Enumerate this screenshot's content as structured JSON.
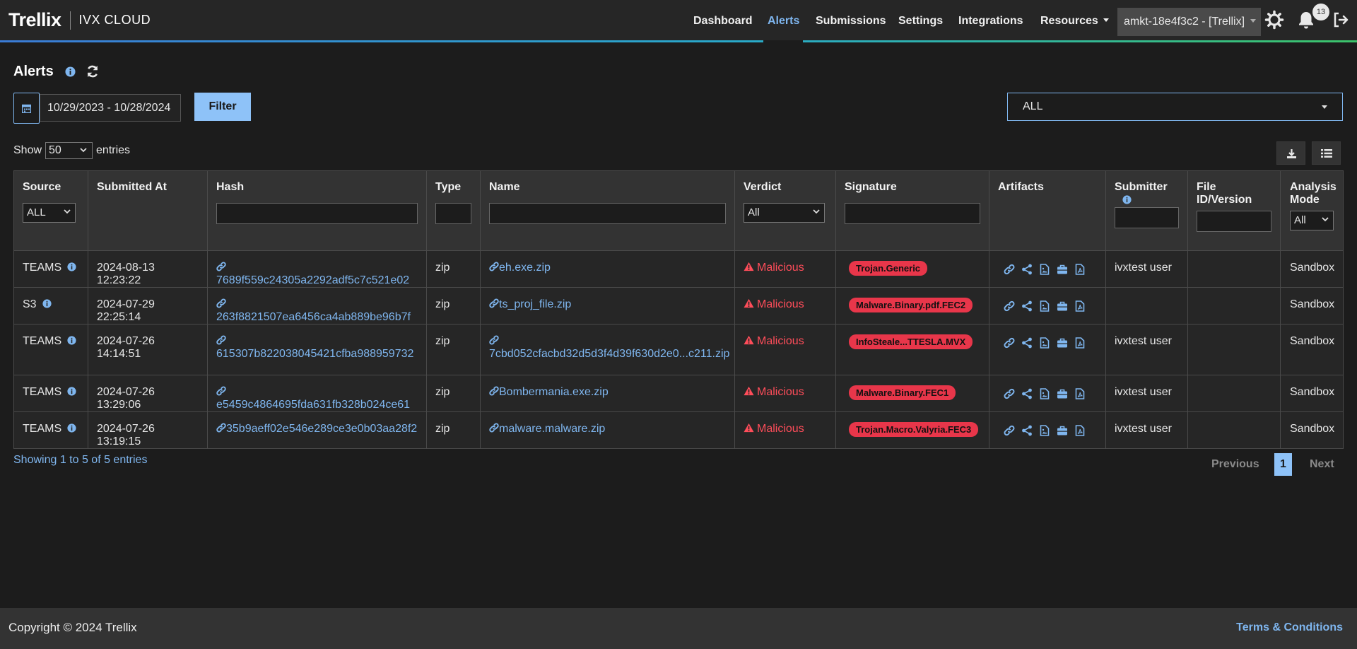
{
  "header": {
    "logo": "Trellix",
    "product": "IVX CLOUD",
    "nav": [
      {
        "label": "Dashboard"
      },
      {
        "label": "Alerts"
      },
      {
        "label": "Submissions"
      },
      {
        "label": "Settings"
      },
      {
        "label": "Integrations"
      },
      {
        "label": "Resources"
      }
    ],
    "active_nav": "Alerts",
    "tenant": "amkt-18e4f3c2 - [Trellix]",
    "notification_count": "13",
    "icons": [
      "gear-icon",
      "bell-icon",
      "logout-icon"
    ]
  },
  "page": {
    "title": "Alerts",
    "date_range": "10/29/2023 - 10/28/2024",
    "filter_label": "Filter",
    "scope_select": "ALL",
    "show_label": "Show",
    "entries_value": "50",
    "entries_label": "entries"
  },
  "table": {
    "columns": {
      "source": "Source",
      "submitted_at": "Submitted At",
      "hash": "Hash",
      "type": "Type",
      "name": "Name",
      "verdict": "Verdict",
      "signature": "Signature",
      "artifacts": "Artifacts",
      "submitter": "Submitter",
      "file_id": "File ID/Version",
      "analysis_mode": "Analysis Mode"
    },
    "filters": {
      "source": "ALL",
      "verdict": "All",
      "analysis_mode": "All"
    },
    "rows": [
      {
        "source": "TEAMS",
        "submitted_at": "2024-08-13 12:23:22",
        "hash": "7689f559c24305a2292adf5c7c521e02",
        "type": "zip",
        "name": "eh.exe.zip",
        "verdict": "Malicious",
        "signature": "Trojan.Generic",
        "submitter": "ivxtest user",
        "file_id": "",
        "analysis_mode": "Sandbox"
      },
      {
        "source": "S3",
        "submitted_at": "2024-07-29 22:25:14",
        "hash": "263f8821507ea6456ca4ab889be96b7f",
        "type": "zip",
        "name": "ts_proj_file.zip",
        "verdict": "Malicious",
        "signature": "Malware.Binary.pdf.FEC2",
        "submitter": "",
        "file_id": "",
        "analysis_mode": "Sandbox"
      },
      {
        "source": "TEAMS",
        "submitted_at": "2024-07-26 14:14:51",
        "hash": "615307b822038045421cfba988959732",
        "type": "zip",
        "name": "7cbd052cfacbd32d5d3f4d39f630d2e0...c211.zip",
        "verdict": "Malicious",
        "signature": "InfoSteale...TTESLA.MVX",
        "submitter": "ivxtest user",
        "file_id": "",
        "analysis_mode": "Sandbox"
      },
      {
        "source": "TEAMS",
        "submitted_at": "2024-07-26 13:29:06",
        "hash": "e5459c4864695fda631fb328b024ce61",
        "type": "zip",
        "name": "Bombermania.exe.zip",
        "verdict": "Malicious",
        "signature": "Malware.Binary.FEC1",
        "submitter": "ivxtest user",
        "file_id": "",
        "analysis_mode": "Sandbox"
      },
      {
        "source": "TEAMS",
        "submitted_at": "2024-07-26 13:19:15",
        "hash": "35b9aeff02e546e289ce3e0b03aa28f2",
        "type": "zip",
        "name": "malware.malware.zip",
        "verdict": "Malicious",
        "signature": "Trojan.Macro.Valyria.FEC3",
        "submitter": "ivxtest user",
        "file_id": "",
        "analysis_mode": "Sandbox"
      }
    ]
  },
  "pagination": {
    "summary": "Showing 1 to 5 of 5 entries",
    "previous": "Previous",
    "page": "1",
    "next": "Next"
  },
  "footer": {
    "copyright": "Copyright © 2024 Trellix",
    "terms": "Terms & Conditions"
  },
  "colors": {
    "accent": "#7fb6ef",
    "button": "#8ec2f8",
    "malicious": "#ff4d5a",
    "signature_badge": "#e8364a",
    "background": "#1c1c1c"
  }
}
